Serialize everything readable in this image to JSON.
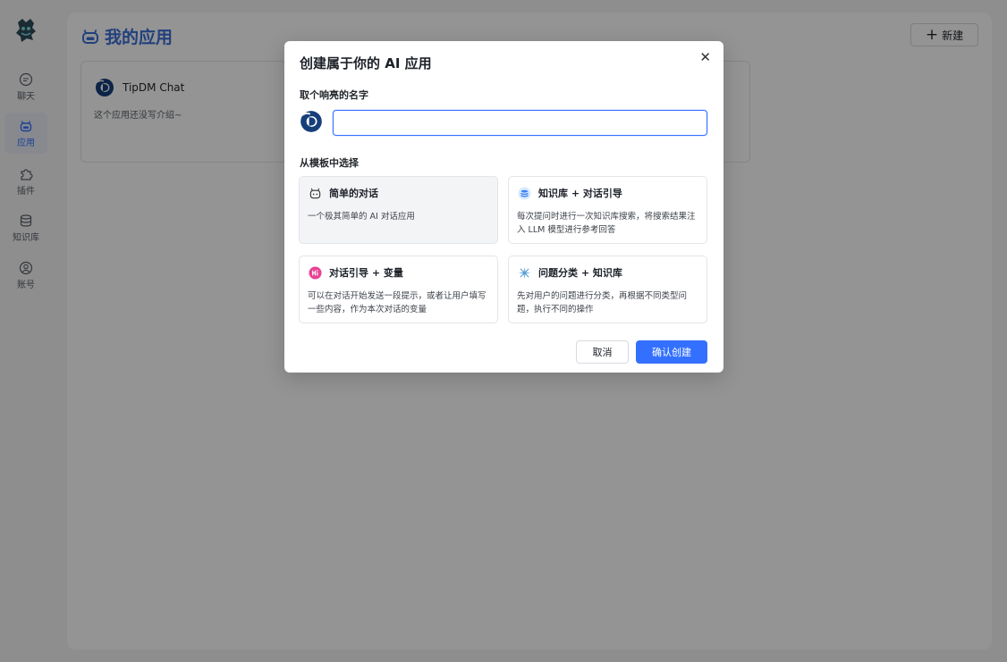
{
  "sidebar": {
    "items": [
      {
        "label": "聊天",
        "icon": "chat-bubble-icon"
      },
      {
        "label": "应用",
        "icon": "app-robot-icon",
        "active": true
      },
      {
        "label": "插件",
        "icon": "plugin-puzzle-icon"
      },
      {
        "label": "知识库",
        "icon": "database-icon"
      },
      {
        "label": "账号",
        "icon": "account-user-icon"
      }
    ]
  },
  "page": {
    "title": "我的应用",
    "new_button_label": "新建"
  },
  "apps": [
    {
      "name": "TipDM Chat",
      "intro": "这个应用还没写介绍~"
    }
  ],
  "modal": {
    "title": "创建属于你的 AI 应用",
    "name_label": "取个响亮的名字",
    "name_value": "",
    "template_label": "从模板中选择",
    "templates": [
      {
        "title": "简单的对话",
        "desc": "一个极其简单的 AI 对话应用",
        "icon": "robot-outline-icon",
        "selected": true
      },
      {
        "title": "知识库 + 对话引导",
        "desc": "每次提问时进行一次知识库搜索，将搜索结果注入 LLM 模型进行参考回答",
        "icon": "database-blue-icon"
      },
      {
        "title": "对话引导 + 变量",
        "desc": "可以在对话开始发送一段提示，或者让用户填写一些内容，作为本次对话的变量",
        "icon": "hi-bubble-icon"
      },
      {
        "title": "问题分类 + 知识库",
        "desc": "先对用户的问题进行分类，再根据不同类型问题，执行不同的操作",
        "icon": "sparkle-icon"
      }
    ],
    "cancel_label": "取消",
    "confirm_label": "确认创建"
  },
  "colors": {
    "accent": "#3370ff",
    "title_blue": "#3b6fd8",
    "overlay": "rgba(0,0,0,0.42)"
  }
}
